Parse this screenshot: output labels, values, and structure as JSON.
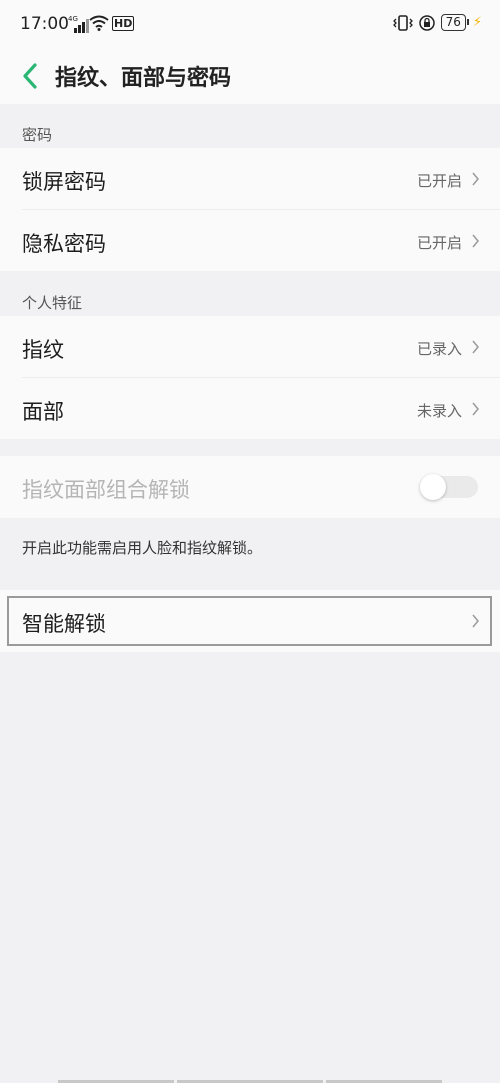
{
  "status": {
    "time": "17:00",
    "network": "4G",
    "hd": "HD",
    "battery": "76",
    "icons": [
      "signal-icon",
      "wifi-icon",
      "vibrate-icon",
      "lock-rotation-icon",
      "battery-icon",
      "charging-icon"
    ]
  },
  "header": {
    "title": "指纹、面部与密码",
    "back_icon": "chevron-left-icon",
    "accent": "#2bb673"
  },
  "sections": {
    "password": {
      "label": "密码",
      "items": [
        {
          "label": "锁屏密码",
          "value": "已开启"
        },
        {
          "label": "隐私密码",
          "value": "已开启"
        }
      ]
    },
    "biometrics": {
      "label": "个人特征",
      "items": [
        {
          "label": "指纹",
          "value": "已录入"
        },
        {
          "label": "面部",
          "value": "未录入"
        }
      ]
    },
    "combo": {
      "label": "指纹面部组合解锁",
      "toggle": "off",
      "hint": "开启此功能需启用人脸和指纹解锁。"
    },
    "smart": {
      "label": "智能解锁"
    }
  }
}
